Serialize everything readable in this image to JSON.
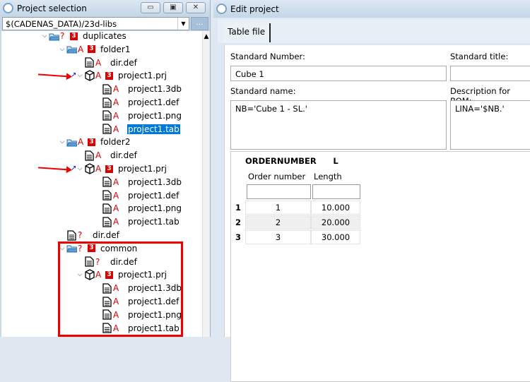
{
  "left_panel": {
    "title": "Project selection",
    "buttons": {
      "minimize": "▭",
      "restore": "▣",
      "close": "✕"
    },
    "path": "$(CADENAS_DATA)/23d-libs",
    "browse_label": "...",
    "tree": [
      {
        "label": "duplicates",
        "depth": 0,
        "icon": "folder",
        "status": "?",
        "badge": "3",
        "expanded": true
      },
      {
        "label": "folder1",
        "depth": 1,
        "icon": "folder",
        "status": "A",
        "badge": "3",
        "expanded": true
      },
      {
        "label": "dir.def",
        "depth": 2,
        "icon": "file",
        "status": "A"
      },
      {
        "label": "project1.prj",
        "depth": 2,
        "icon": "cube",
        "status": "A",
        "badge": "3",
        "expanded": true,
        "link": true,
        "marked": true
      },
      {
        "label": "project1.3db",
        "depth": 3,
        "icon": "file",
        "status": "A"
      },
      {
        "label": "project1.def",
        "depth": 3,
        "icon": "file",
        "status": "A"
      },
      {
        "label": "project1.png",
        "depth": 3,
        "icon": "file",
        "status": "A"
      },
      {
        "label": "project1.tab",
        "depth": 3,
        "icon": "file",
        "status": "A",
        "selected": true
      },
      {
        "label": "folder2",
        "depth": 1,
        "icon": "folder",
        "status": "A",
        "badge": "3",
        "expanded": true
      },
      {
        "label": "dir.def",
        "depth": 2,
        "icon": "file",
        "status": "A"
      },
      {
        "label": "project1.prj",
        "depth": 2,
        "icon": "cube",
        "status": "A",
        "badge": "3",
        "expanded": true,
        "link": true,
        "marked": true
      },
      {
        "label": "project1.3db",
        "depth": 3,
        "icon": "file",
        "status": "A"
      },
      {
        "label": "project1.def",
        "depth": 3,
        "icon": "file",
        "status": "A"
      },
      {
        "label": "project1.png",
        "depth": 3,
        "icon": "file",
        "status": "A"
      },
      {
        "label": "project1.tab",
        "depth": 3,
        "icon": "file",
        "status": "A"
      },
      {
        "label": "dir.def",
        "depth": 1,
        "icon": "file",
        "status": "?"
      },
      {
        "label": "common",
        "depth": 1,
        "icon": "folder",
        "status": "?",
        "badge": "3",
        "expanded": true
      },
      {
        "label": "dir.def",
        "depth": 2,
        "icon": "file",
        "status": "?"
      },
      {
        "label": "project1.prj",
        "depth": 2,
        "icon": "cube",
        "status": "A",
        "badge": "3",
        "expanded": true
      },
      {
        "label": "project1.3db",
        "depth": 3,
        "icon": "file",
        "status": "A"
      },
      {
        "label": "project1.def",
        "depth": 3,
        "icon": "file",
        "status": "A"
      },
      {
        "label": "project1.png",
        "depth": 3,
        "icon": "file",
        "status": "A"
      },
      {
        "label": "project1.tab",
        "depth": 3,
        "icon": "file",
        "status": "A"
      }
    ]
  },
  "right_panel": {
    "title": "Edit project",
    "tab": "Table file",
    "standard_number_label": "Standard Number:",
    "standard_number": "Cube 1",
    "standard_title_label": "Standard title:",
    "standard_title": "",
    "standard_name_label": "Standard name:",
    "standard_name": "NB='Cube 1 - SL.'",
    "bom_label": "Description for BOM:",
    "bom": "LINA='$NB.'",
    "table": {
      "columns": [
        {
          "name": "ORDERNUMBER",
          "desc": "Order number"
        },
        {
          "name": "L",
          "desc": "Length"
        }
      ],
      "rows": [
        [
          "1",
          "1",
          "10.000"
        ],
        [
          "2",
          "2",
          "20.000"
        ],
        [
          "3",
          "3",
          "30.000"
        ]
      ]
    }
  },
  "colors": {
    "selection": "#0078d7",
    "status_red": "#e00000",
    "badge": "#dd0000"
  }
}
